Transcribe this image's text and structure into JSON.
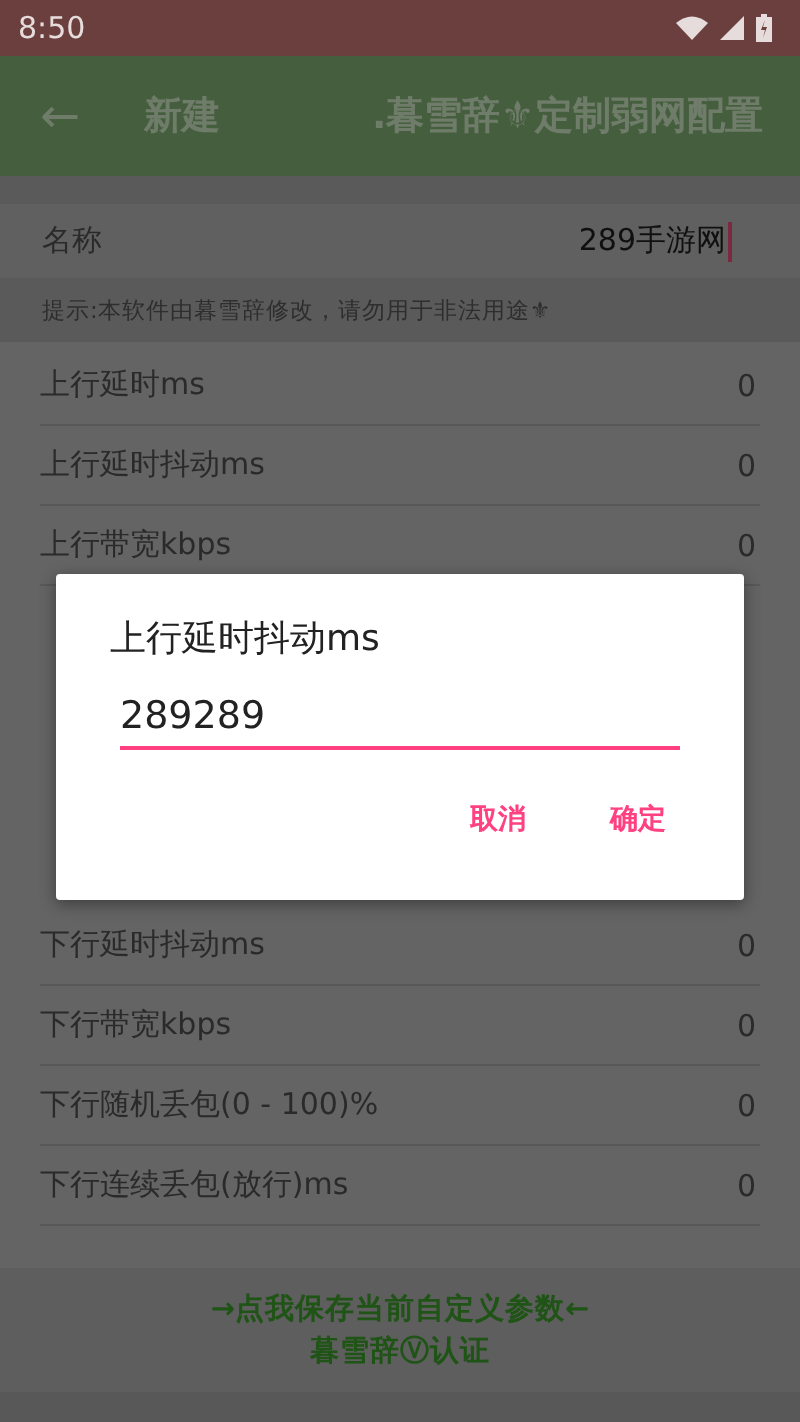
{
  "status_bar": {
    "time": "8:50"
  },
  "app_bar": {
    "back": "←",
    "title": "新建",
    "subtitle": ".暮雪辞⚜定制弱网配置"
  },
  "name_field": {
    "label": "名称",
    "value": "289手游网"
  },
  "hint": "提示:本软件由暮雪辞修改，请勿用于非法用途⚜",
  "settings": [
    {
      "label": "上行延时ms",
      "value": "0"
    },
    {
      "label": "上行延时抖动ms",
      "value": "0"
    },
    {
      "label": "上行带宽kbps",
      "value": "0"
    },
    {
      "label": "下行延时抖动ms",
      "value": "0"
    },
    {
      "label": "下行带宽kbps",
      "value": "0"
    },
    {
      "label": "下行随机丢包(0 - 100)%",
      "value": "0"
    },
    {
      "label": "下行连续丢包(放行)ms",
      "value": "0"
    }
  ],
  "footer": {
    "lines": [
      "→点我保存当前自定义参数←",
      "暮雪辞Ⓥ认证"
    ]
  },
  "dialog": {
    "title": "上行延时抖动ms",
    "value": "289289",
    "buttons": [
      "取消",
      "确定"
    ]
  }
}
